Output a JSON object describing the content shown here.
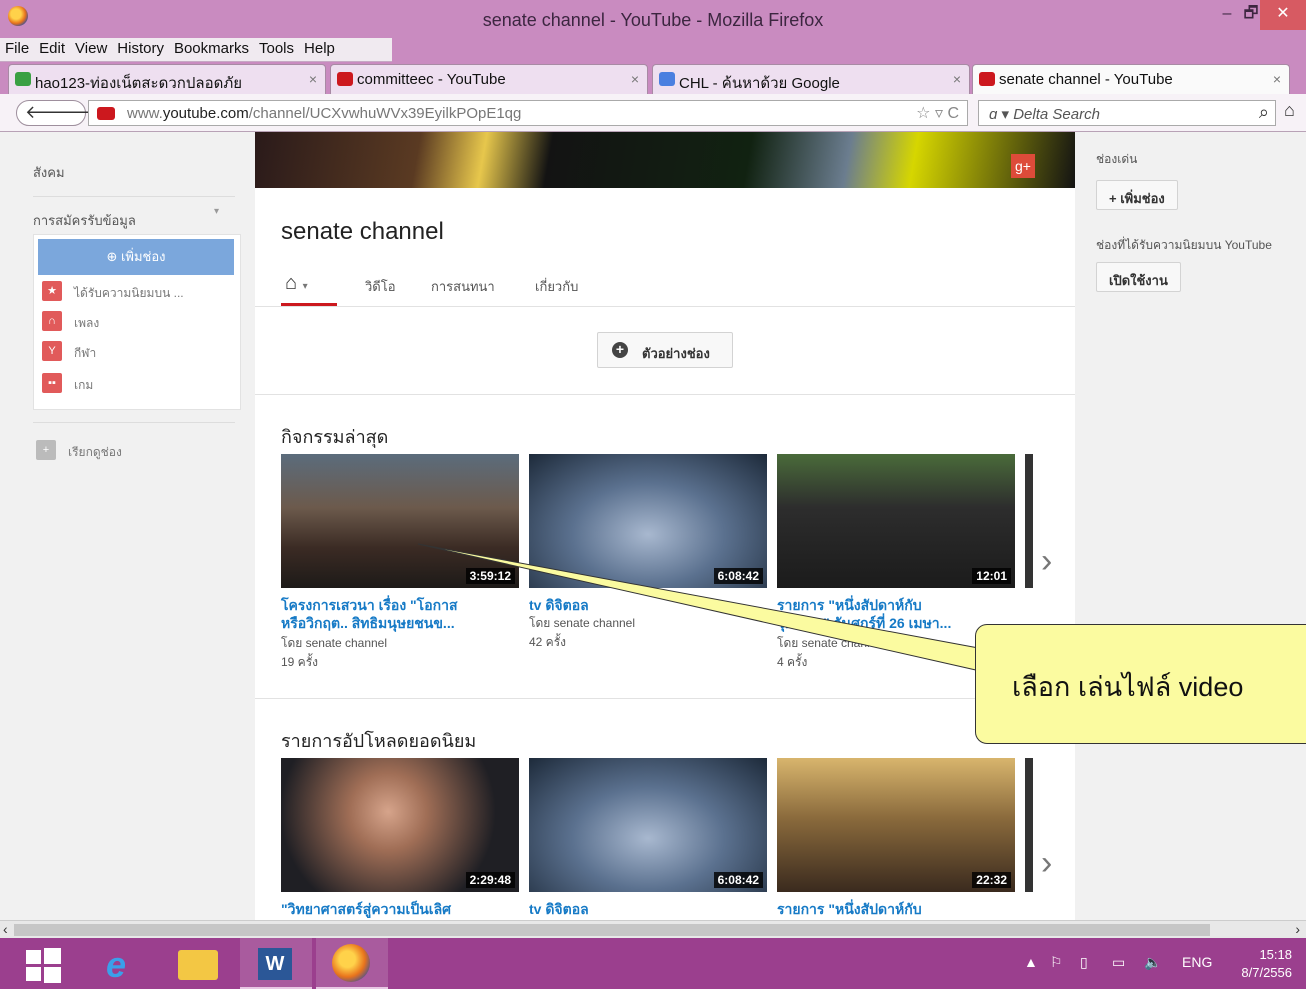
{
  "window": {
    "title": "senate channel - YouTube - Mozilla Firefox",
    "minimize": "–",
    "maximize": "🗗",
    "close": "✕"
  },
  "menu": [
    "File",
    "Edit",
    "View",
    "History",
    "Bookmarks",
    "Tools",
    "Help"
  ],
  "tabs": [
    {
      "label": "hao123-ท่องเน็ตสะดวกปลอดภัย",
      "icon_color": "#3aa043"
    },
    {
      "label": "committeec - YouTube",
      "icon_color": "#cc181e"
    },
    {
      "label": "CHL - ค้นหาด้วย Google",
      "icon_color": "#4a7fe0"
    },
    {
      "label": "senate channel - YouTube",
      "icon_color": "#cc181e"
    }
  ],
  "nav": {
    "url_prefix": "www.",
    "url_domain": "youtube.com",
    "url_path": "/channel/UCXvwhuWVx39EyilkPOpE1qg",
    "search_placeholder": "Delta Search"
  },
  "guide": {
    "top_item": "สังคม",
    "subscriptions_heading": "การสมัครรับข้อมูล",
    "add_channel": "เพิ่มช่อง",
    "items": [
      {
        "label": "ได้รับความนิยมบน ...",
        "icon": "star-icon"
      },
      {
        "label": "เพลง",
        "icon": "headphones-icon"
      },
      {
        "label": "กีฬา",
        "icon": "trophy-icon"
      },
      {
        "label": "เกม",
        "icon": "gamepad-icon"
      }
    ],
    "browse_channels": "เรียกดูช่อง"
  },
  "channel": {
    "name": "senate channel",
    "tabs": [
      "วิดีโอ",
      "การสนทนา",
      "เกี่ยวกับ"
    ],
    "example_button": "ตัวอย่างช่อง"
  },
  "sections": [
    {
      "title": "กิจกรรมล่าสุด",
      "videos": [
        {
          "duration": "3:59:12",
          "title_line1": "โครงการเสวนา เรื่อง \"โอกาส",
          "title_line2": "หรือวิกฤต.. สิทธิมนุษยชนข...",
          "by": "โดย senate channel",
          "views": "19 ครั้ง"
        },
        {
          "duration": "6:08:42",
          "title_line1": "tv ดิจิตอล",
          "title_line2": "",
          "by": "โดย senate channel",
          "views": "42 ครั้ง"
        },
        {
          "duration": "12:01",
          "title_line1": "รายการ \"หนึ่งสัปดาห์กับ",
          "title_line2": "วุฒิสภา\" วันศุกร์ที่ 26 เมษา...",
          "by": "โดย senate channel",
          "views": "4 ครั้ง"
        }
      ]
    },
    {
      "title": "รายการอัปโหลดยอดนิยม",
      "videos": [
        {
          "duration": "2:29:48",
          "title_line1": "\"วิทยาศาสตร์สู่ความเป็นเลิศ"
        },
        {
          "duration": "6:08:42",
          "title_line1": "tv ดิจิตอล"
        },
        {
          "duration": "22:32",
          "title_line1": "รายการ \"หนึ่งสัปดาห์กับ"
        }
      ]
    }
  ],
  "right": {
    "featured_label": "ช่องเด่น",
    "add_channel_button": "+ เพิ่มช่อง",
    "popular_label": "ช่องที่ได้รับความนิยมบน YouTube",
    "enable_button": "เปิดใช้งาน"
  },
  "callout": "เลือก เล่นไฟล์ video",
  "taskbar": {
    "language": "ENG",
    "time": "15:18",
    "date": "8/7/2556"
  }
}
